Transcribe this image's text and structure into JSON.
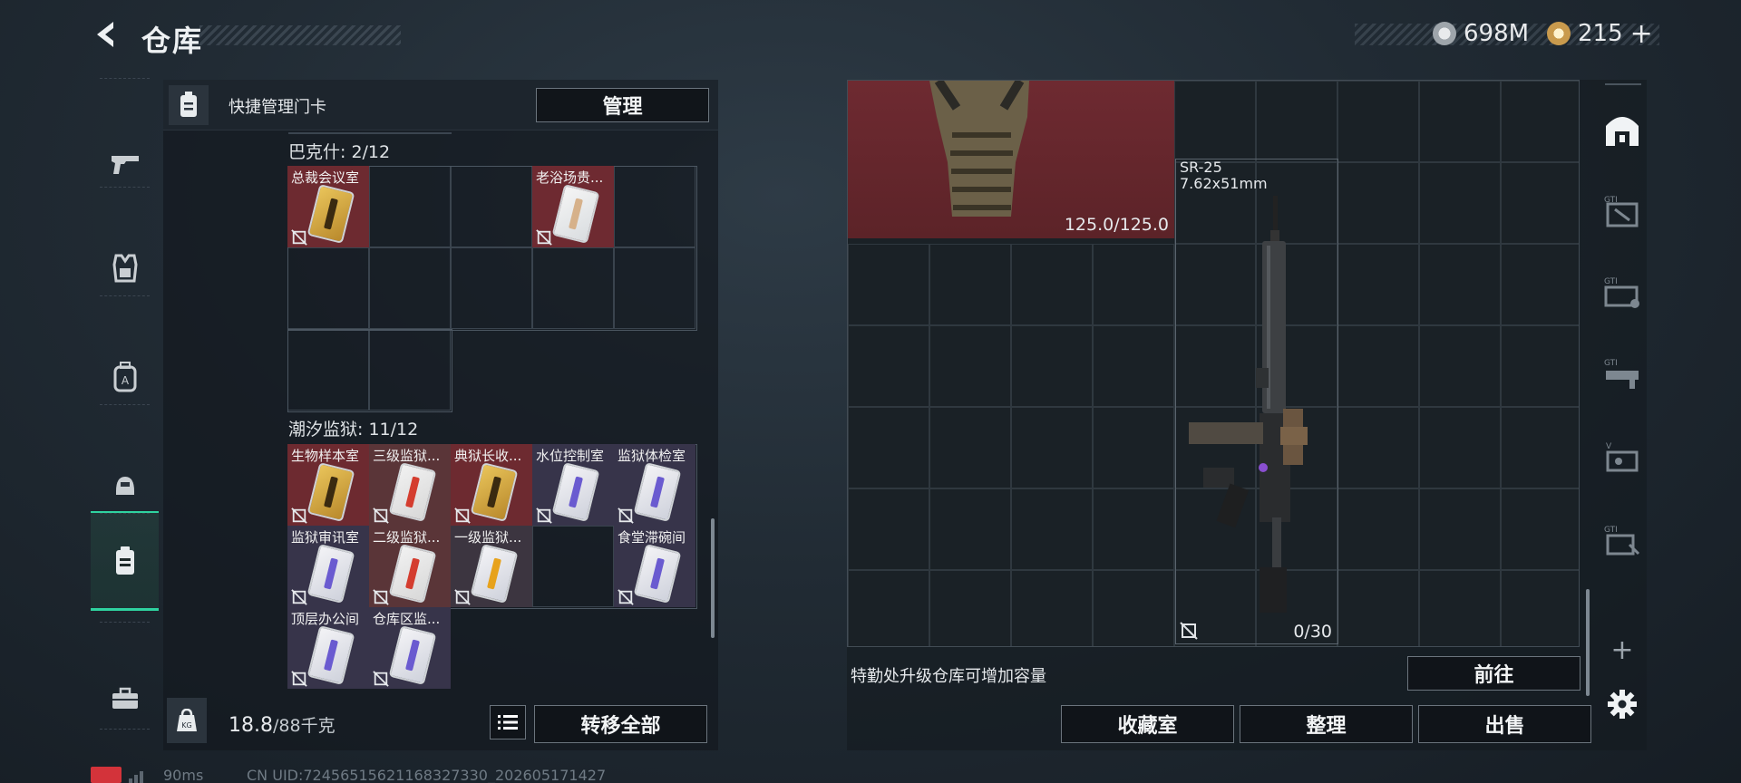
{
  "header": {
    "title": "仓库",
    "currency1": "698M",
    "currency2": "215",
    "currency2_add": "+"
  },
  "nav": {
    "items": [
      "weapon",
      "armor",
      "backpack",
      "helmet",
      "keycard",
      "toolbox"
    ]
  },
  "left": {
    "quick_label": "快捷管理门卡",
    "manage_label": "管理",
    "section1": {
      "title": "巴克什: 2/12",
      "cards": [
        {
          "name": "总裁会议室",
          "color": "gold"
        },
        {
          "name": "老浴场贵...",
          "color": "white"
        }
      ]
    },
    "section2": {
      "title": "潮汐监狱: 11/12",
      "cards": [
        {
          "name": "生物样本室",
          "color": "gold"
        },
        {
          "name": "三级监狱...",
          "color": "red"
        },
        {
          "name": "典狱长收...",
          "color": "gold"
        },
        {
          "name": "水位控制室",
          "color": "purple"
        },
        {
          "name": "监狱体检室",
          "color": "purple"
        },
        {
          "name": "监狱审讯室",
          "color": "purple"
        },
        {
          "name": "二级监狱...",
          "color": "red"
        },
        {
          "name": "一级监狱...",
          "color": "orange"
        },
        {
          "name": "",
          "color": ""
        },
        {
          "name": "食堂滞碗间",
          "color": "purple"
        },
        {
          "name": "顶层办公间",
          "color": "purple"
        },
        {
          "name": "仓库区监...",
          "color": "purple"
        }
      ]
    },
    "weight_value": "18.8",
    "weight_total": "/88千克",
    "transfer_label": "转移全部"
  },
  "right": {
    "armor_durability": "125.0/125.0",
    "gun_name": "SR-25",
    "gun_caliber": "7.62x51mm",
    "gun_ammo": "0/30",
    "upgrade_hint": "特勤处升级仓库可增加容量",
    "goto_label": "前往",
    "collection_label": "收藏室",
    "sort_label": "整理",
    "sell_label": "出售"
  },
  "status": {
    "ping": "90ms",
    "uid": "CN UID:72456515621168327330_202605171427"
  },
  "colors": {
    "accent": "#2fd3a0",
    "red_slot": "#6b2329",
    "gold_slot": "#5a2a2e",
    "purple_slot": "#3a3550"
  }
}
